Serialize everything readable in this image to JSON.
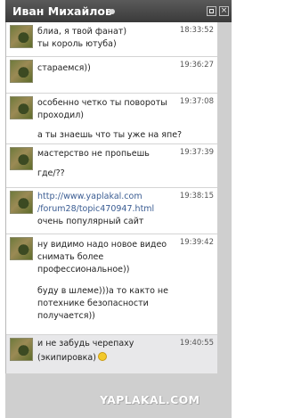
{
  "window": {
    "title": "Иван Михайлов"
  },
  "messages": [
    {
      "time": "18:33:52",
      "lines": [
        "блиа, я твой фанат)",
        "ты король ютуба)"
      ]
    },
    {
      "time": "19:36:27",
      "lines": [
        "стараемся))"
      ]
    },
    {
      "time": "19:37:08",
      "lines": [
        "особенно четко ты повороты",
        "проходил)",
        "а ты знаешь что ты уже на япе?"
      ]
    },
    {
      "time": "19:37:39",
      "lines": [
        "мастерство не пропьешь",
        "где/??"
      ]
    },
    {
      "time": "19:38:15",
      "lines": [
        "http://www.yaplakal.com",
        "/forum28/topic470947.html",
        "очень популярный сайт"
      ]
    },
    {
      "time": "19:39:42",
      "lines": [
        "ну видимо надо новое видео",
        "снимать более",
        "профессиональное))",
        "буду в шлеме)))а то както не",
        "потехнике безопасности",
        "получается))"
      ]
    },
    {
      "time": "19:40:55",
      "lines": [
        "и не забудь черепаху",
        "(экипировка)"
      ],
      "emoji": "smile-emoji"
    }
  ],
  "watermark": "YAPLAKAL.COM"
}
